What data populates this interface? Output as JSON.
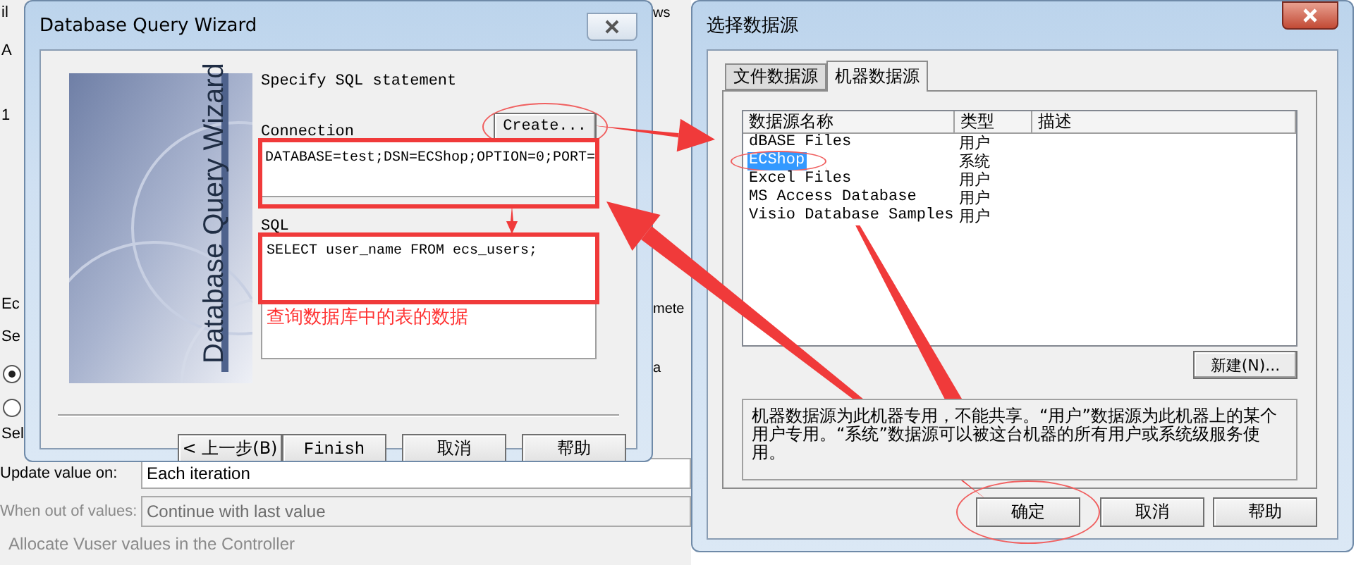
{
  "background_window": {
    "fragments_left": [
      {
        "kind": "text",
        "text": "il"
      },
      {
        "kind": "text",
        "text": "A"
      },
      {
        "kind": "text",
        "text": "1"
      },
      {
        "kind": "text",
        "text": "Ec"
      },
      {
        "kind": "text",
        "text": "Se"
      },
      {
        "kind": "radio",
        "selected": true
      },
      {
        "kind": "radio",
        "selected": false
      },
      {
        "kind": "text",
        "text": "Sel"
      }
    ],
    "fragments_right": [
      "ws",
      "mete",
      "a"
    ],
    "fields": [
      {
        "label": "Update value on:",
        "value": "Each iteration",
        "disabled": false
      },
      {
        "label": "When out of values:",
        "value": "Continue with last value",
        "disabled": true
      }
    ],
    "group_title": "Allocate Vuser values in the Controller"
  },
  "wizard": {
    "title": "Database Query Wizard",
    "banner_text": "Database Query Wizard",
    "heading": "Specify SQL statement",
    "create_button": "Create...",
    "connection_label": "Connection",
    "connection_value": "DATABASE=test;DSN=ECShop;OPTION=0;PORT=",
    "sql_label": "SQL",
    "sql_value": "SELECT user_name FROM ecs_users;",
    "buttons": [
      {
        "label": "< 上一步(B)"
      },
      {
        "label": "Finish"
      },
      {
        "label": "取消"
      },
      {
        "label": "帮助"
      }
    ]
  },
  "data_source_dialog": {
    "title": "选择数据源",
    "tabs": [
      {
        "label": "文件数据源",
        "selected": false
      },
      {
        "label": "机器数据源",
        "selected": true
      }
    ],
    "columns": [
      "数据源名称",
      "类型",
      "描述"
    ],
    "rows": [
      {
        "name": "dBASE Files",
        "type": "用户",
        "selected": false
      },
      {
        "name": "ECShop",
        "type": "系统",
        "selected": true
      },
      {
        "name": "Excel Files",
        "type": "用户",
        "selected": false
      },
      {
        "name": "MS Access Database",
        "type": "用户",
        "selected": false
      },
      {
        "name": "Visio Database Samples",
        "type": "用户",
        "selected": false
      }
    ],
    "new_button": "新建(N)...",
    "description": "机器数据源为此机器专用，不能共享。“用户”数据源为此机器上的某个用户专用。“系统”数据源可以被这台机器的所有用户或系统级服务使用。",
    "buttons": [
      {
        "label": "确定"
      },
      {
        "label": "取消"
      },
      {
        "label": "帮助"
      }
    ]
  },
  "annotation": {
    "note": "查询数据库中的表的数据"
  }
}
